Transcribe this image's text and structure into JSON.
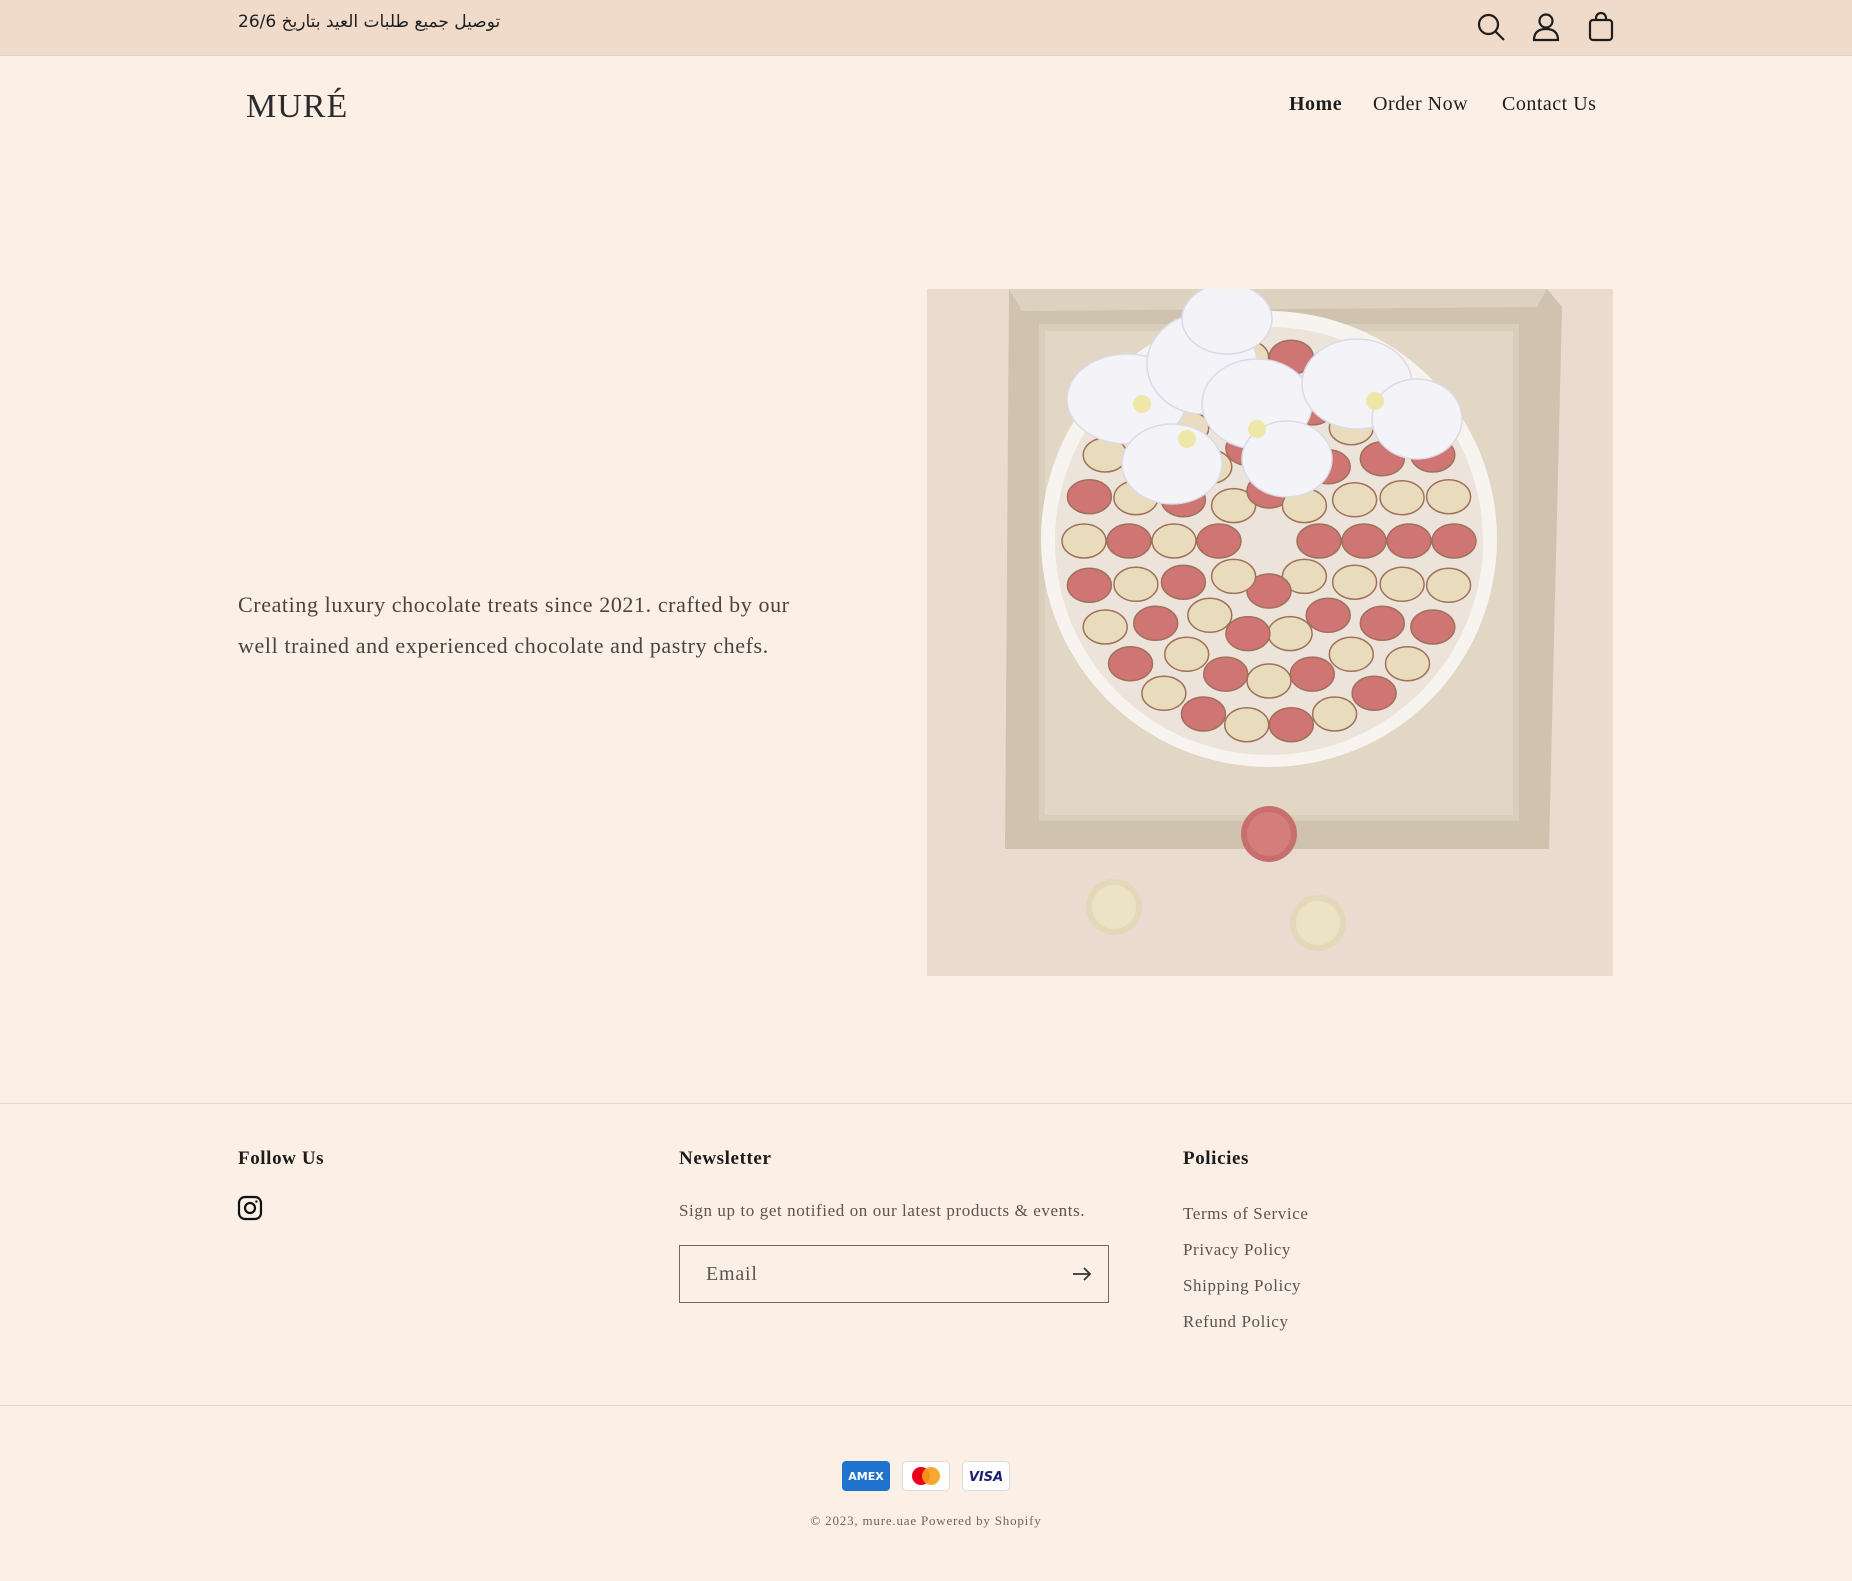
{
  "announcement": {
    "text": "توصيل جميع طلبات العيد بتاريخ 26/6"
  },
  "header": {
    "logo": "MURÉ",
    "nav": [
      {
        "label": "Home",
        "active": true
      },
      {
        "label": "Order Now",
        "active": false
      },
      {
        "label": "Contact Us",
        "active": false
      }
    ],
    "icons": [
      "search-icon",
      "account-icon",
      "cart-icon"
    ]
  },
  "hero": {
    "text": "Creating luxury chocolate treats since 2021. crafted by our well trained and experienced chocolate and pastry chefs."
  },
  "footer": {
    "follow": {
      "heading": "Follow Us",
      "icon": "instagram-icon"
    },
    "newsletter": {
      "heading": "Newsletter",
      "subtitle": "Sign up to get notified on our latest products & events.",
      "email_placeholder": "Email"
    },
    "policies": {
      "heading": "Policies",
      "links": [
        "Terms of Service",
        "Privacy Policy",
        "Shipping Policy",
        "Refund Policy"
      ]
    },
    "payments": [
      "AMEX",
      "Mastercard",
      "VISA"
    ],
    "copyright_prefix": "© 2023,",
    "copyright_store": "mure.uae",
    "copyright_powered": "Powered by Shopify"
  },
  "colors": {
    "page_bg": "#fbefe6",
    "announcement_bg": "#f0dac9",
    "text": "#222222"
  }
}
